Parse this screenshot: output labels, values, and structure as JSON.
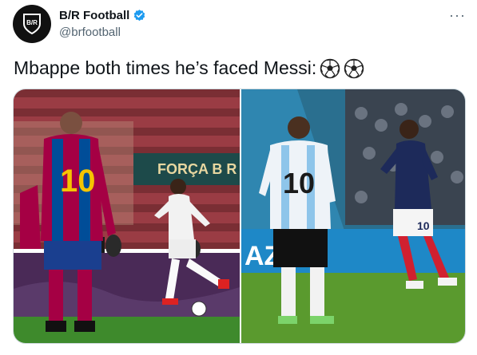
{
  "author": {
    "display_name": "B/R Football",
    "handle": "@brfootball",
    "avatar_icon": "br-logo-icon",
    "verified_icon": "verified-badge-icon"
  },
  "menu": {
    "label": "···",
    "icon": "more-options-icon"
  },
  "tweet": {
    "text": "Mbappe both times he’s faced Messi:",
    "emoji_icons": [
      "soccer-ball-icon",
      "soccer-ball-icon"
    ]
  },
  "media": {
    "photos": [
      {
        "banner_text": "FORÇA B R",
        "jersey_number": "10"
      },
      {
        "ad_text": "AZU",
        "jersey_number_messi": "10",
        "jersey_number_mbappe": "10"
      }
    ]
  },
  "colors": {
    "verified": "#1d9bf0",
    "text": "#0f1419",
    "muted": "#536471"
  }
}
